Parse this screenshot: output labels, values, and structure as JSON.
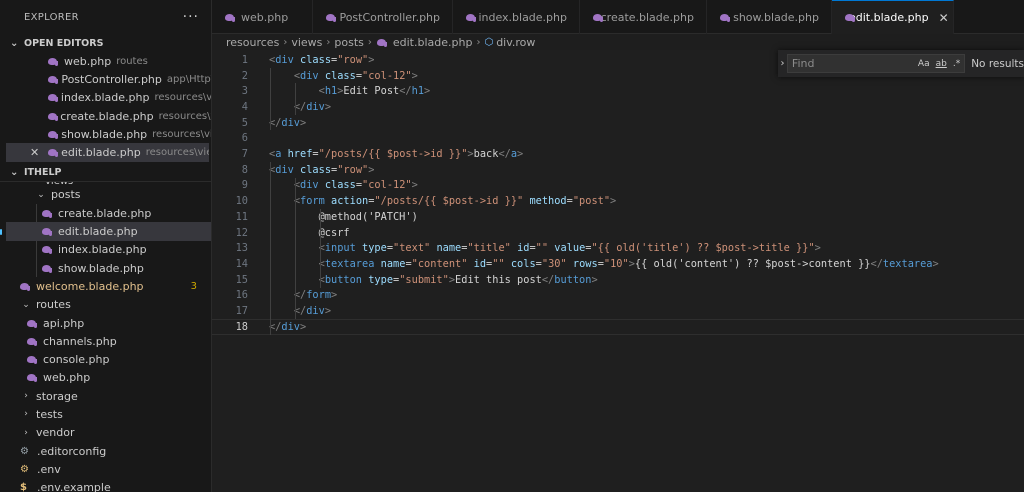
{
  "sidebar": {
    "title": "EXPLORER",
    "more": "···",
    "open_editors_header": "OPEN EDITORS",
    "open_editors": [
      {
        "name": "web.php",
        "path": "routes"
      },
      {
        "name": "PostController.php",
        "path": "app\\Http\\..."
      },
      {
        "name": "index.blade.php",
        "path": "resources\\vie..."
      },
      {
        "name": "create.blade.php",
        "path": "resources\\vie..."
      },
      {
        "name": "show.blade.php",
        "path": "resources\\vie..."
      },
      {
        "name": "edit.blade.php",
        "path": "resources\\view..."
      }
    ],
    "project_header": "ITHELP",
    "partial_label": "views",
    "tree": {
      "posts": "posts",
      "posts_files": [
        "create.blade.php",
        "edit.blade.php",
        "index.blade.php",
        "show.blade.php"
      ],
      "welcome": "welcome.blade.php",
      "welcome_badge": "3",
      "routes": "routes",
      "routes_files": [
        "api.php",
        "channels.php",
        "console.php",
        "web.php"
      ],
      "storage": "storage",
      "tests": "tests",
      "vendor": "vendor",
      "editorconfig": ".editorconfig",
      "env": ".env",
      "env_example": ".env.example"
    }
  },
  "tabs": [
    "web.php",
    "PostController.php",
    "index.blade.php",
    "create.blade.php",
    "show.blade.php",
    "edit.blade.php"
  ],
  "tab_close": "✕",
  "breadcrumb": [
    "resources",
    "views",
    "posts",
    "edit.blade.php",
    "div.row"
  ],
  "find": {
    "placeholder": "Find",
    "opt_case": "Aa",
    "opt_word": "ab",
    "opt_regex": ".*",
    "result": "No results"
  },
  "editor": {
    "line_numbers": [
      "1",
      "2",
      "3",
      "4",
      "5",
      "6",
      "7",
      "8",
      "9",
      "10",
      "11",
      "12",
      "13",
      "14",
      "15",
      "16",
      "17",
      "18"
    ],
    "current_line": 18,
    "lines": [
      [
        [
          "t",
          "<"
        ],
        [
          "tag",
          "div"
        ],
        [
          "txt",
          " "
        ],
        [
          "attr",
          "class"
        ],
        [
          "txt",
          "="
        ],
        [
          "str",
          "\"row\""
        ],
        [
          "t",
          ">"
        ]
      ],
      [
        [
          "txt",
          "    "
        ],
        [
          "t",
          "<"
        ],
        [
          "tag",
          "div"
        ],
        [
          "txt",
          " "
        ],
        [
          "attr",
          "class"
        ],
        [
          "txt",
          "="
        ],
        [
          "str",
          "\"col-12\""
        ],
        [
          "t",
          ">"
        ]
      ],
      [
        [
          "txt",
          "        "
        ],
        [
          "t",
          "<"
        ],
        [
          "tag",
          "h1"
        ],
        [
          "t",
          ">"
        ],
        [
          "txt",
          "Edit Post"
        ],
        [
          "t",
          "</"
        ],
        [
          "tag",
          "h1"
        ],
        [
          "t",
          ">"
        ]
      ],
      [
        [
          "txt",
          "    "
        ],
        [
          "t",
          "</"
        ],
        [
          "tag",
          "div"
        ],
        [
          "t",
          ">"
        ]
      ],
      [
        [
          "t",
          "</"
        ],
        [
          "tag",
          "div"
        ],
        [
          "t",
          ">"
        ]
      ],
      [],
      [
        [
          "t",
          "<"
        ],
        [
          "tag",
          "a"
        ],
        [
          "txt",
          " "
        ],
        [
          "attr",
          "href"
        ],
        [
          "txt",
          "="
        ],
        [
          "str",
          "\"/posts/{{ $post->id }}\""
        ],
        [
          "t",
          ">"
        ],
        [
          "txt",
          "back"
        ],
        [
          "t",
          "</"
        ],
        [
          "tag",
          "a"
        ],
        [
          "t",
          ">"
        ]
      ],
      [
        [
          "t",
          "<"
        ],
        [
          "tag",
          "div"
        ],
        [
          "txt",
          " "
        ],
        [
          "attr",
          "class"
        ],
        [
          "txt",
          "="
        ],
        [
          "str",
          "\"row\""
        ],
        [
          "t",
          ">"
        ]
      ],
      [
        [
          "txt",
          "    "
        ],
        [
          "t",
          "<"
        ],
        [
          "tag",
          "div"
        ],
        [
          "txt",
          " "
        ],
        [
          "attr",
          "class"
        ],
        [
          "txt",
          "="
        ],
        [
          "str",
          "\"col-12\""
        ],
        [
          "t",
          ">"
        ]
      ],
      [
        [
          "txt",
          "    "
        ],
        [
          "t",
          "<"
        ],
        [
          "tag",
          "form"
        ],
        [
          "txt",
          " "
        ],
        [
          "attr",
          "action"
        ],
        [
          "txt",
          "="
        ],
        [
          "str",
          "\"/posts/{{ $post->id }}\""
        ],
        [
          "txt",
          " "
        ],
        [
          "attr",
          "method"
        ],
        [
          "txt",
          "="
        ],
        [
          "str",
          "\"post\""
        ],
        [
          "t",
          ">"
        ]
      ],
      [
        [
          "txt",
          "        @method('PATCH')"
        ]
      ],
      [
        [
          "txt",
          "        @csrf"
        ]
      ],
      [
        [
          "txt",
          "        "
        ],
        [
          "t",
          "<"
        ],
        [
          "tag",
          "input"
        ],
        [
          "txt",
          " "
        ],
        [
          "attr",
          "type"
        ],
        [
          "txt",
          "="
        ],
        [
          "str",
          "\"text\""
        ],
        [
          "txt",
          " "
        ],
        [
          "attr",
          "name"
        ],
        [
          "txt",
          "="
        ],
        [
          "str",
          "\"title\""
        ],
        [
          "txt",
          " "
        ],
        [
          "attr",
          "id"
        ],
        [
          "txt",
          "="
        ],
        [
          "str",
          "\"\""
        ],
        [
          "txt",
          " "
        ],
        [
          "attr",
          "value"
        ],
        [
          "txt",
          "="
        ],
        [
          "str",
          "\"{{ old('title') ?? $post->title }}\""
        ],
        [
          "t",
          ">"
        ]
      ],
      [
        [
          "txt",
          "        "
        ],
        [
          "t",
          "<"
        ],
        [
          "tag",
          "textarea"
        ],
        [
          "txt",
          " "
        ],
        [
          "attr",
          "name"
        ],
        [
          "txt",
          "="
        ],
        [
          "str",
          "\"content\""
        ],
        [
          "txt",
          " "
        ],
        [
          "attr",
          "id"
        ],
        [
          "txt",
          "="
        ],
        [
          "str",
          "\"\""
        ],
        [
          "txt",
          " "
        ],
        [
          "attr",
          "cols"
        ],
        [
          "txt",
          "="
        ],
        [
          "str",
          "\"30\""
        ],
        [
          "txt",
          " "
        ],
        [
          "attr",
          "rows"
        ],
        [
          "txt",
          "="
        ],
        [
          "str",
          "\"10\""
        ],
        [
          "t",
          ">"
        ],
        [
          "txt",
          "{{ old('content') ?? $post->content }}"
        ],
        [
          "t",
          "</"
        ],
        [
          "tag",
          "textarea"
        ],
        [
          "t",
          ">"
        ]
      ],
      [
        [
          "txt",
          "        "
        ],
        [
          "t",
          "<"
        ],
        [
          "tag",
          "button"
        ],
        [
          "txt",
          " "
        ],
        [
          "attr",
          "type"
        ],
        [
          "txt",
          "="
        ],
        [
          "str",
          "\"submit\""
        ],
        [
          "t",
          ">"
        ],
        [
          "txt",
          "Edit this post"
        ],
        [
          "t",
          "</"
        ],
        [
          "tag",
          "button"
        ],
        [
          "t",
          ">"
        ]
      ],
      [
        [
          "txt",
          "    "
        ],
        [
          "t",
          "</"
        ],
        [
          "tag",
          "form"
        ],
        [
          "t",
          ">"
        ]
      ],
      [
        [
          "txt",
          "    "
        ],
        [
          "t",
          "</"
        ],
        [
          "tag",
          "div"
        ],
        [
          "t",
          ">"
        ]
      ],
      [
        [
          "t",
          "</"
        ],
        [
          "tag",
          "div"
        ],
        [
          "t",
          ">"
        ]
      ]
    ]
  }
}
